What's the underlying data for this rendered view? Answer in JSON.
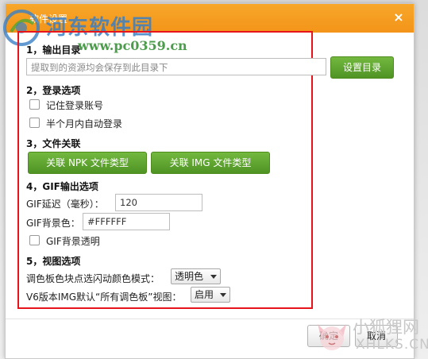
{
  "dialog": {
    "title": "软件设置",
    "close_label": "×"
  },
  "watermark": {
    "site_name": "河东软件园",
    "url": "www.pc0359.cn",
    "site2_name": "小狐狸网",
    "site2_url": "XHLKS.CN"
  },
  "sections": {
    "output_dir": {
      "heading": "1，输出目录",
      "placeholder": "提取到的资源均会保存到此目录下",
      "set_button": "设置目录"
    },
    "login": {
      "heading": "2，登录选项",
      "remember": "记住登录账号",
      "auto_login": "半个月内自动登录"
    },
    "file_assoc": {
      "heading": "3，文件关联",
      "npk_button": "关联 NPK 文件类型",
      "img_button": "关联 IMG 文件类型"
    },
    "gif": {
      "heading": "4，GIF输出选项",
      "delay_label": "GIF延迟（毫秒）：",
      "delay_value": "120",
      "bg_label": "GIF背景色：",
      "bg_value": "#FFFFFF",
      "transparent_label": "GIF背景透明"
    },
    "view": {
      "heading": "5，视图选项",
      "palette_label": "调色板色块点选闪动颜色模式：",
      "palette_value": "透明色",
      "v6_label": "V6版本IMG默认“所有调色板”视图：",
      "v6_value": "启用"
    }
  },
  "footer": {
    "ok_label": "确定",
    "cancel_label": "取消"
  },
  "colors": {
    "title_bar": "#f39419",
    "green_button": "#5aa12c",
    "highlight_border": "#e8141b"
  }
}
